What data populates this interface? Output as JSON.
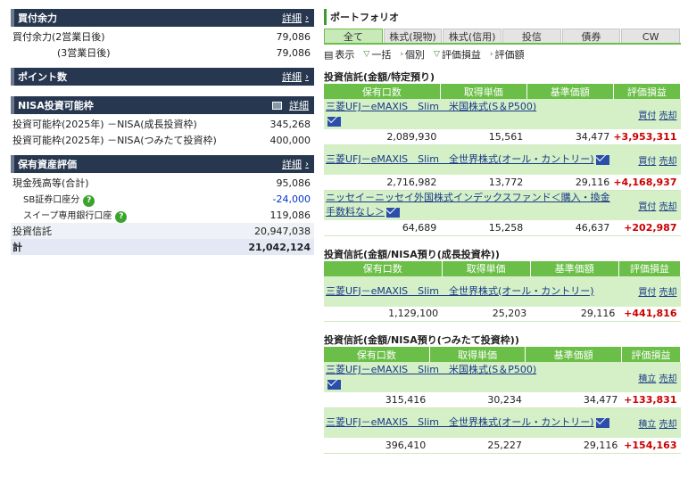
{
  "left": {
    "kaitsuke": {
      "title": "買付余力",
      "detail": "詳細",
      "rows": [
        {
          "label": "買付余力(2営業日後)",
          "value": "79,086"
        },
        {
          "label": "(3営業日後)",
          "value": "79,086"
        }
      ]
    },
    "points": {
      "title": "ポイント数",
      "detail": "詳細"
    },
    "nisa": {
      "title": "NISA投資可能枠",
      "detail": "詳細",
      "rows": [
        {
          "label": "投資可能枠(2025年)",
          "type": "－NISA(成長投資枠)",
          "value": "345,268"
        },
        {
          "label": "投資可能枠(2025年)",
          "type": "－NISA(つみたて投資枠)",
          "value": "400,000"
        }
      ]
    },
    "assets": {
      "title": "保有資産評価",
      "detail": "詳細",
      "cash_label": "現金残高等(合計)",
      "cash_value": "95,086",
      "sb_label": "SB証券口座分",
      "sb_value": "-24,000",
      "sweep_label": "スイープ専用銀行口座",
      "sweep_value": "119,086",
      "trust_label": "投資信託",
      "trust_value": "20,947,038",
      "total_label": "計",
      "total_value": "21,042,124"
    }
  },
  "portfolio": {
    "title": "ポートフォリオ",
    "tabs": [
      "全て",
      "株式(現物)",
      "株式(信用)",
      "投信",
      "債券",
      "CW"
    ],
    "options": {
      "display": "表示",
      "bulk": "一括",
      "individual": "個別",
      "pnl": "評価損益",
      "value": "評価額"
    },
    "columns": [
      "保有口数",
      "取得単価",
      "基準価額",
      "評価損益"
    ],
    "sections": [
      {
        "title": "投資信託(金額/特定預り)",
        "funds": [
          {
            "name": "三菱UFJ－eMAXIS　Slim　米国株式(S＆P500)",
            "a1": "買付",
            "a2": "売却",
            "units": "2,089,930",
            "cost": "15,561",
            "nav": "34,477",
            "pnl": "+3,953,311"
          },
          {
            "name": "三菱UFJ－eMAXIS　Slim　全世界株式(オール・カントリー)",
            "a1": "買付",
            "a2": "売却",
            "units": "2,716,982",
            "cost": "13,772",
            "nav": "29,116",
            "pnl": "+4,168,937"
          },
          {
            "name": "ニッセイ－ニッセイ外国株式インデックスファンド＜購入・換金手数料なし＞",
            "a1": "買付",
            "a2": "売却",
            "units": "64,689",
            "cost": "15,258",
            "nav": "46,637",
            "pnl": "+202,987"
          }
        ]
      },
      {
        "title": "投資信託(金額/NISA預り(成長投資枠))",
        "funds": [
          {
            "name": "三菱UFJ－eMAXIS　Slim　全世界株式(オール・カントリー)",
            "a1": "買付",
            "a2": "売却",
            "units": "1,129,100",
            "cost": "25,203",
            "nav": "29,116",
            "pnl": "+441,816"
          }
        ]
      },
      {
        "title": "投資信託(金額/NISA預り(つみたて投資枠))",
        "funds": [
          {
            "name": "三菱UFJ－eMAXIS　Slim　米国株式(S＆P500)",
            "a1": "積立",
            "a2": "売却",
            "units": "315,416",
            "cost": "30,234",
            "nav": "34,477",
            "pnl": "+133,831"
          },
          {
            "name": "三菱UFJ－eMAXIS　Slim　全世界株式(オール・カントリー)",
            "a1": "積立",
            "a2": "売却",
            "units": "396,410",
            "cost": "25,227",
            "nav": "29,116",
            "pnl": "+154,163"
          }
        ]
      }
    ]
  }
}
